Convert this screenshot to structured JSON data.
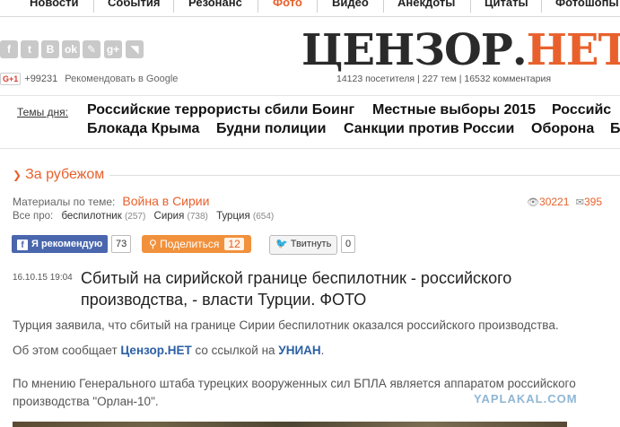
{
  "topnav": {
    "items": [
      "Новости",
      "События",
      "Резонанс",
      "Фото",
      "Видео",
      "Анекдоты",
      "Цитаты",
      "Фотошопы"
    ],
    "active": "Фото"
  },
  "social": {
    "icons": [
      "facebook-icon",
      "twitter-icon",
      "vkontakte-icon",
      "odnoklassniki-icon",
      "livejournal-icon",
      "google-plus-icon",
      "rss-icon"
    ],
    "gplus_label": "G+1",
    "gplus_count": "+99231",
    "gplus_recommend": "Рекомендовать в Google"
  },
  "logo": {
    "part1": "ЦЕНЗОР",
    "dot": ".",
    "part2": "НЕТ"
  },
  "stats": "14123 посетителя | 227 тем | 16532 комментария",
  "topics": {
    "label": "Темы дня:",
    "row1": [
      "Российские террористы сбили Боинг",
      "Местные выборы 2015",
      "Российс"
    ],
    "row2": [
      "Блокада Крыма",
      "Будни полиции",
      "Санкции против России",
      "Оборона",
      "Б"
    ]
  },
  "section": {
    "title": "За рубежом"
  },
  "meta": {
    "materials_label": "Материалы по теме:",
    "materials_link": "Война в Сирии",
    "all_about_label": "Все про:",
    "tags": [
      {
        "name": "беспилотник",
        "count": "(257)"
      },
      {
        "name": "Сирия",
        "count": "(738)"
      },
      {
        "name": "Турция",
        "count": "(654)"
      }
    ],
    "views": "30221",
    "comments": "395"
  },
  "share": {
    "fb_label": "Я рекомендую",
    "fb_count": "73",
    "ok_label": "Поделиться",
    "ok_count": "12",
    "tw_label": "Твитнуть",
    "tw_count": "0"
  },
  "article": {
    "date": "16.10.15 19:04",
    "headline": "Сбитый на сирийской границе беспилотник - российского производства, - власти Турции. ФОТО",
    "p1": "Турция заявила, что сбитый на границе Сирии беспилотник оказался российского производства.",
    "p2_pre": "Об этом сообщает ",
    "p2_src1": "Цензор.НЕТ",
    "p2_mid": " со ссылкой на ",
    "p2_src2": "УНИАН",
    "p2_post": ".",
    "p3": "По мнению Генерального штаба турецких вооруженных сил БПЛА является аппаратом российского производства \"Орлан-10\"."
  },
  "watermark": "YAPLAKAL.COM"
}
